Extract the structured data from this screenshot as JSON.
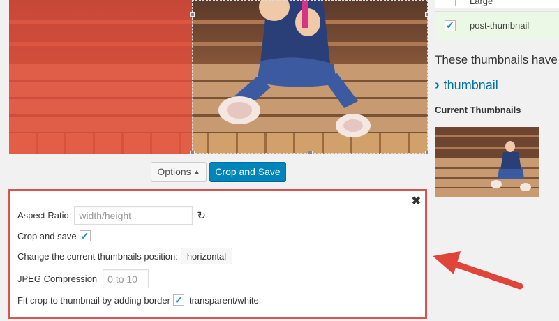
{
  "crop_toolbar": {
    "options_label": "Options",
    "crop_save_label": "Crop and Save"
  },
  "options_panel": {
    "close_symbol": "✖",
    "aspect_ratio_label": "Aspect Ratio:",
    "aspect_ratio_placeholder": "width/height",
    "crop_and_save_label": "Crop and save",
    "crop_and_save_checked": true,
    "position_label": "Change the current thumbnails position:",
    "position_button": "horizontal",
    "jpeg_label": "JPEG Compression",
    "jpeg_placeholder": "0 to 10",
    "fit_border_label": "Fit crop to thumbnail by adding border",
    "fit_border_checked": true,
    "fit_border_option": "transparent/white"
  },
  "sidebar": {
    "sizes": [
      {
        "label": "Large",
        "checked": false
      },
      {
        "label": "post-thumbnail",
        "checked": true
      }
    ],
    "these_thumbnails_text": "These thumbnails have",
    "thumbnail_link": "thumbnail",
    "current_thumbnails_title": "Current Thumbnails"
  },
  "colors": {
    "primary_button": "#0085ba",
    "crop_overlay": "#e74c3c",
    "highlight_border": "#d9534f",
    "link": "#0073aa",
    "selected_row": "#eaf8e5"
  }
}
